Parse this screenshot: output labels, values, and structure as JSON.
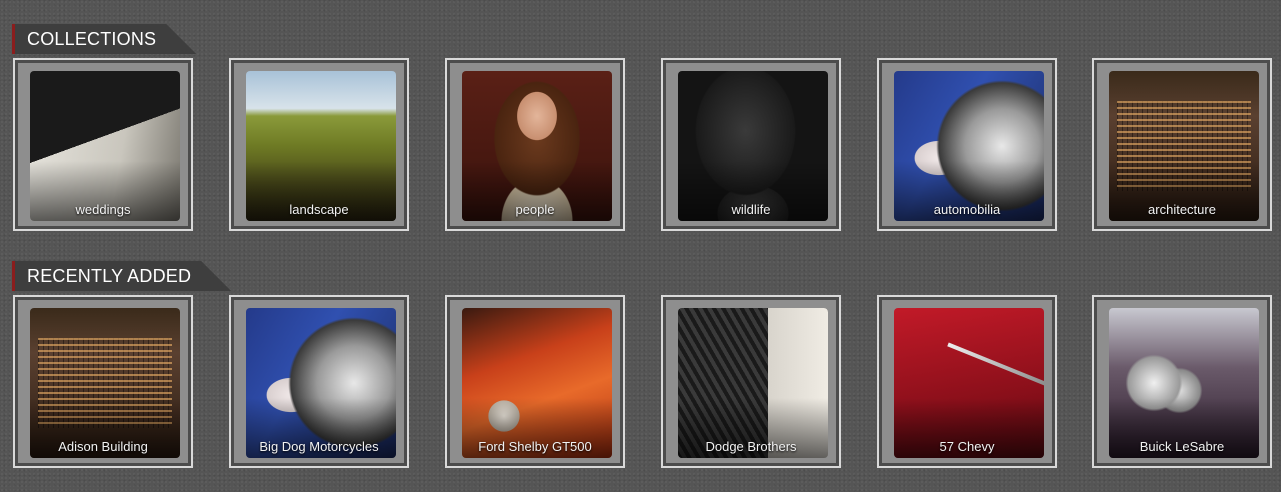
{
  "sections": {
    "collections": {
      "title": "COLLECTIONS",
      "items": [
        {
          "label": "weddings",
          "thumb": "wedding-rings-on-piano-keys"
        },
        {
          "label": "landscape",
          "thumb": "green-field-under-sky"
        },
        {
          "label": "people",
          "thumb": "girl-portrait"
        },
        {
          "label": "wildlife",
          "thumb": "dark-animal-closeup"
        },
        {
          "label": "automobilia",
          "thumb": "big-dog-motorcycle-engine"
        },
        {
          "label": "architecture",
          "thumb": "city-buildings-at-night"
        }
      ]
    },
    "recently_added": {
      "title": "RECENTLY ADDED",
      "items": [
        {
          "label": "Adison Building",
          "thumb": "city-buildings-at-night"
        },
        {
          "label": "Big Dog Motorcycles",
          "thumb": "big-dog-motorcycle-engine"
        },
        {
          "label": "Ford Shelby GT500",
          "thumb": "orange-shelby-front"
        },
        {
          "label": "Dodge Brothers",
          "thumb": "chrome-grille"
        },
        {
          "label": "57 Chevy",
          "thumb": "red-chevy-fin"
        },
        {
          "label": "Buick LeSabre",
          "thumb": "buick-headlights"
        }
      ]
    }
  },
  "colors": {
    "background": "#555555",
    "header_accent": "#8b1d1d",
    "card_border": "#d9d9d9",
    "card_mat": "#8e8e8e"
  }
}
